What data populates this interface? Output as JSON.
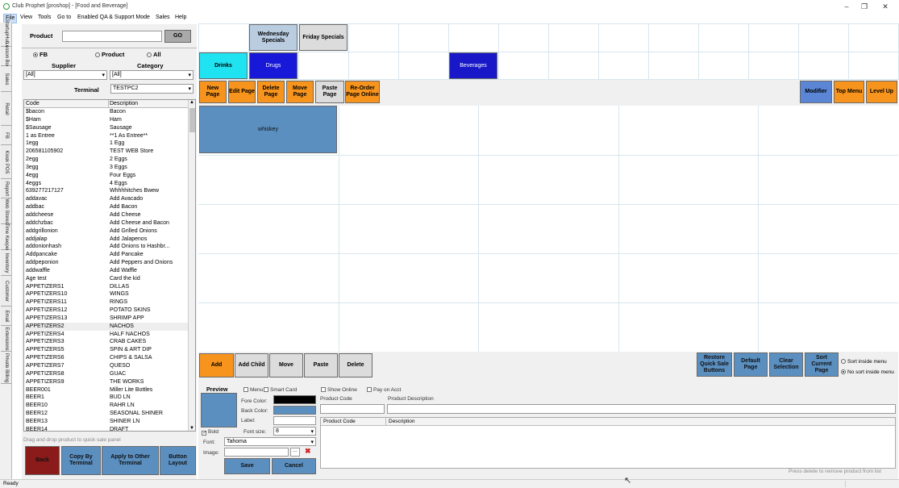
{
  "window": {
    "title": "Club Prophet [proshop] - [Food and Beverage]",
    "min_icon": "minimize-icon",
    "max_icon": "restore-icon",
    "close_icon": "close-icon"
  },
  "menu": [
    "File",
    "View",
    "Tools",
    "Go to",
    "Enabled QA & Support Mode",
    "Sales",
    "Help"
  ],
  "side_tabs": [
    "StartupHub v3",
    "Lesson Book",
    "Sales",
    "Retail",
    "FB",
    "Kiosk POS",
    "Report",
    "Web Stores",
    "Time Keeper",
    "Inventory",
    "Customer",
    "Email",
    "Extensions",
    "Private Billing"
  ],
  "left": {
    "product_label": "Product",
    "product_value": "",
    "go_label": "GO",
    "radio_fb": "FB",
    "radio_product": "Product",
    "radio_all": "All",
    "supplier_label": "Supplier",
    "category_label": "Category",
    "supplier_value": "[All]",
    "category_value": "[All]",
    "terminal_label": "Terminal",
    "terminal_value": "TESTPC2",
    "col_code": "Code",
    "col_desc": "Description",
    "rows": [
      [
        "$bacon",
        "Bacon"
      ],
      [
        "$Ham",
        "Ham"
      ],
      [
        "$Sausage",
        "Sausage"
      ],
      [
        "1 as Entree",
        "**1 As Entree**"
      ],
      [
        "1egg",
        "1 Egg"
      ],
      [
        "206581105902",
        "TEST WEB Store"
      ],
      [
        "2egg",
        "2 Eggs"
      ],
      [
        "3egg",
        "3 Eggs"
      ],
      [
        "4egg",
        "Four Eggs"
      ],
      [
        "4eggs",
        "4 Eggs"
      ],
      [
        "639277217127",
        "Whhhhitches Bwew"
      ],
      [
        "addavac",
        "Add Avacado"
      ],
      [
        "addbac",
        "Add Bacon"
      ],
      [
        "addcheese",
        "Add Cheese"
      ],
      [
        "addchzbac",
        "Add Cheese and Bacon"
      ],
      [
        "addgrillonion",
        "Add Grilled Onions"
      ],
      [
        "addjalap",
        "Add Jalapenos"
      ],
      [
        "addonionhash",
        "Add Onions to Hashbr..."
      ],
      [
        "Addpancake",
        "Add Pancake"
      ],
      [
        "addpeponion",
        "Add Peppers and Onions"
      ],
      [
        "addwaffle",
        "Add Waffle"
      ],
      [
        "Age test",
        "Card the kid"
      ],
      [
        "APPETIZERS1",
        "DILLAS"
      ],
      [
        "APPETIZERS10",
        "WINGS"
      ],
      [
        "APPETIZERS11",
        "RINGS"
      ],
      [
        "APPETIZERS12",
        "POTATO SKINS"
      ],
      [
        "APPETIZERS13",
        "SHRIMP APP"
      ],
      [
        "APPETIZERS2",
        "NACHOS"
      ],
      [
        "APPETIZERS4",
        "HALF NACHOS"
      ],
      [
        "APPETIZERS3",
        "CRAB CAKES"
      ],
      [
        "APPETIZERS5",
        "SPIN & ART DIP"
      ],
      [
        "APPETIZERS6",
        "CHIPS & SALSA"
      ],
      [
        "APPETIZERS7",
        "QUESO"
      ],
      [
        "APPETIZERS8",
        "GUAC"
      ],
      [
        "APPETIZERS9",
        "THE WORKS"
      ],
      [
        "BEER001",
        "Miller Lite Bottles"
      ],
      [
        "BEER1",
        "BUD LN"
      ],
      [
        "BEER10",
        "RAHR LN"
      ],
      [
        "BEER12",
        "SEASONAL SHINER"
      ],
      [
        "BEER13",
        "SHINER LN"
      ],
      [
        "BEER14",
        "DRAFT"
      ]
    ],
    "drag_hint": "Drag and drop product to quick sale panel",
    "back": "Back",
    "copy_by_terminal": "Copy By Terminal",
    "apply_other": "Apply to Other Terminal",
    "button_layout": "Button Layout"
  },
  "top": {
    "wednesday": "Wednesday Specials",
    "friday": "Friday Specials",
    "drinks": "Drinks",
    "drugs": "Drugs",
    "beverages": "Beverages",
    "new_page": "New Page",
    "edit_page": "Edit Page",
    "delete_page": "Delete Page",
    "move_page": "Move Page",
    "paste_page": "Paste Page",
    "reorder": "Re-Order Page Online",
    "modifier": "Modifier",
    "top_menu": "Top Menu",
    "level_up": "Level Up"
  },
  "button_grid": {
    "whiskey": "whiskey"
  },
  "bottom": {
    "add": "Add",
    "add_child": "Add Child",
    "move": "Move",
    "paste": "Paste",
    "delete": "Delete",
    "restore": "Restore Quick Sale Buttons",
    "default_page": "Default Page",
    "clear_selection": "Clear Selection",
    "sort_current": "Sort Current Page",
    "sort_inside": "Sort inside menu",
    "no_sort": "No sort inside menu",
    "preview": "Preview",
    "menu_chk": "Menu",
    "smart_card": "Smart Card",
    "show_online": "Show Online",
    "pay_on_acct": "Pay on Acct",
    "fore_color": "Fore Color:",
    "back_color": "Back Color:",
    "label": "Label:",
    "bold": "Bold",
    "font_size_label": "Font size:",
    "font_size": "8",
    "font_label": "Font:",
    "font_value": "Tahoma",
    "image_label": "Image:",
    "product_code": "Product Code",
    "product_desc": "Product Description",
    "grid_code": "Product Code",
    "grid_desc": "Description",
    "save": "Save",
    "cancel": "Cancel",
    "remove_hint": "Press delete to remove product from list"
  },
  "status": {
    "text": "Ready"
  },
  "colors": {
    "accent_orange": "#f7941d",
    "steel_blue": "#5b8fc0",
    "back_red": "#8b1a1a"
  }
}
